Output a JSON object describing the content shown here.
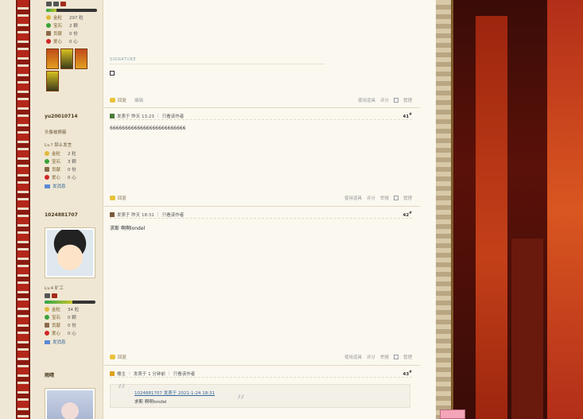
{
  "posts": [
    {
      "floor": "",
      "user": {
        "name": "",
        "title": "",
        "stats": [
          {
            "icon": "gold-coin-icon",
            "label": "金粒",
            "value": "297 粒"
          },
          {
            "icon": "emerald-icon",
            "label": "宝石",
            "value": "2 颗"
          },
          {
            "icon": "gift-icon",
            "label": "贡献",
            "value": "0 份"
          },
          {
            "icon": "heart-icon",
            "label": "爱心",
            "value": "0 心"
          }
        ],
        "xp_fraction": 0.2
      },
      "signature_label": "SIGNATURE",
      "signature_text": "",
      "footer": {
        "reply": "回复",
        "rate_link": "编辑",
        "tools": "使用道具",
        "rate": "评分",
        "report": "",
        "manage": "管理"
      }
    },
    {
      "floor": "41",
      "user": {
        "name": "yu20010714",
        "title": "头像被屏蔽",
        "level": "Lv.? 禁止发言",
        "stats": [
          {
            "icon": "gold-coin-icon",
            "label": "金粒",
            "value": "2 粒"
          },
          {
            "icon": "emerald-icon",
            "label": "宝石",
            "value": "3 颗"
          },
          {
            "icon": "gift-icon",
            "label": "贡献",
            "value": "0 份"
          },
          {
            "icon": "heart-icon",
            "label": "爱心",
            "value": "0 心"
          }
        ],
        "send_msg": "发消息"
      },
      "posted": "发表于 昨天 13:23",
      "only_author": "只看该作者",
      "body": "6666666666666666666666666",
      "footer": {
        "reply": "回复",
        "tools": "使用道具",
        "rate": "评分",
        "report": "举报",
        "manage": "管理"
      }
    },
    {
      "floor": "42",
      "user": {
        "name": "1024881707",
        "level": "Lv.4 矿工",
        "stats": [
          {
            "icon": "gold-coin-icon",
            "label": "金粒",
            "value": "34 粒"
          },
          {
            "icon": "emerald-icon",
            "label": "宝石",
            "value": "0 颗"
          },
          {
            "icon": "gift-icon",
            "label": "贡献",
            "value": "0 份"
          },
          {
            "icon": "heart-icon",
            "label": "爱心",
            "value": "0 心"
          }
        ],
        "xp_fraction": 0.55,
        "send_msg": "发消息"
      },
      "posted": "发表于 昨天 18:31",
      "only_author": "只看该作者",
      "body": "求斯 啊啊londel",
      "footer": {
        "reply": "回复",
        "tools": "使用道具",
        "rate": "评分",
        "report": "举报",
        "manage": "管理"
      }
    },
    {
      "floor": "43",
      "user": {
        "name": "雨晴"
      },
      "posted_by": "楼主",
      "posted": "发表于 1 分钟前",
      "only_author": "只看该作者",
      "quote": {
        "author_line": "1024881707 发表于 2021-1-24 18:31",
        "text": "求斯 啊啊londel"
      }
    }
  ],
  "colors": {
    "accent": "#336699",
    "sidebar_bg": "#efe7d3",
    "page_bg": "#fbf8f0",
    "chain_red": "#b4261a"
  }
}
